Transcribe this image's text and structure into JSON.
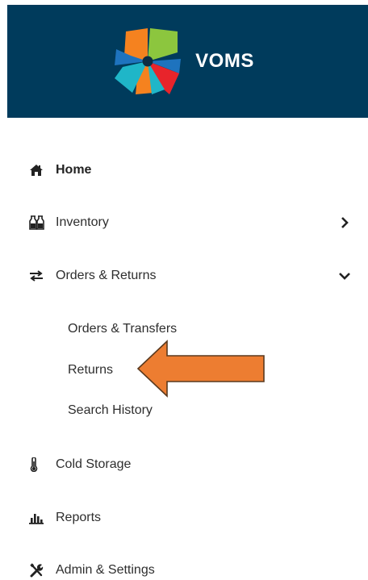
{
  "brand": {
    "name": "VOMS",
    "color": "#003b5c",
    "accent": "#ed7d31"
  },
  "nav": {
    "home": {
      "label": "Home",
      "icon": "home-icon"
    },
    "inventory": {
      "label": "Inventory",
      "icon": "vials-icon",
      "state": "collapsed"
    },
    "orders": {
      "label": "Orders & Returns",
      "icon": "exchange-icon",
      "state": "expanded",
      "children": [
        {
          "label": "Orders & Transfers"
        },
        {
          "label": "Returns"
        },
        {
          "label": "Search History"
        }
      ]
    },
    "cold_storage": {
      "label": "Cold Storage",
      "icon": "thermometer-icon"
    },
    "reports": {
      "label": "Reports",
      "icon": "bar-chart-icon"
    },
    "admin": {
      "label": "Admin & Settings",
      "icon": "tools-icon"
    }
  },
  "annotation": {
    "target": "Returns",
    "color": "#ed7d31"
  }
}
